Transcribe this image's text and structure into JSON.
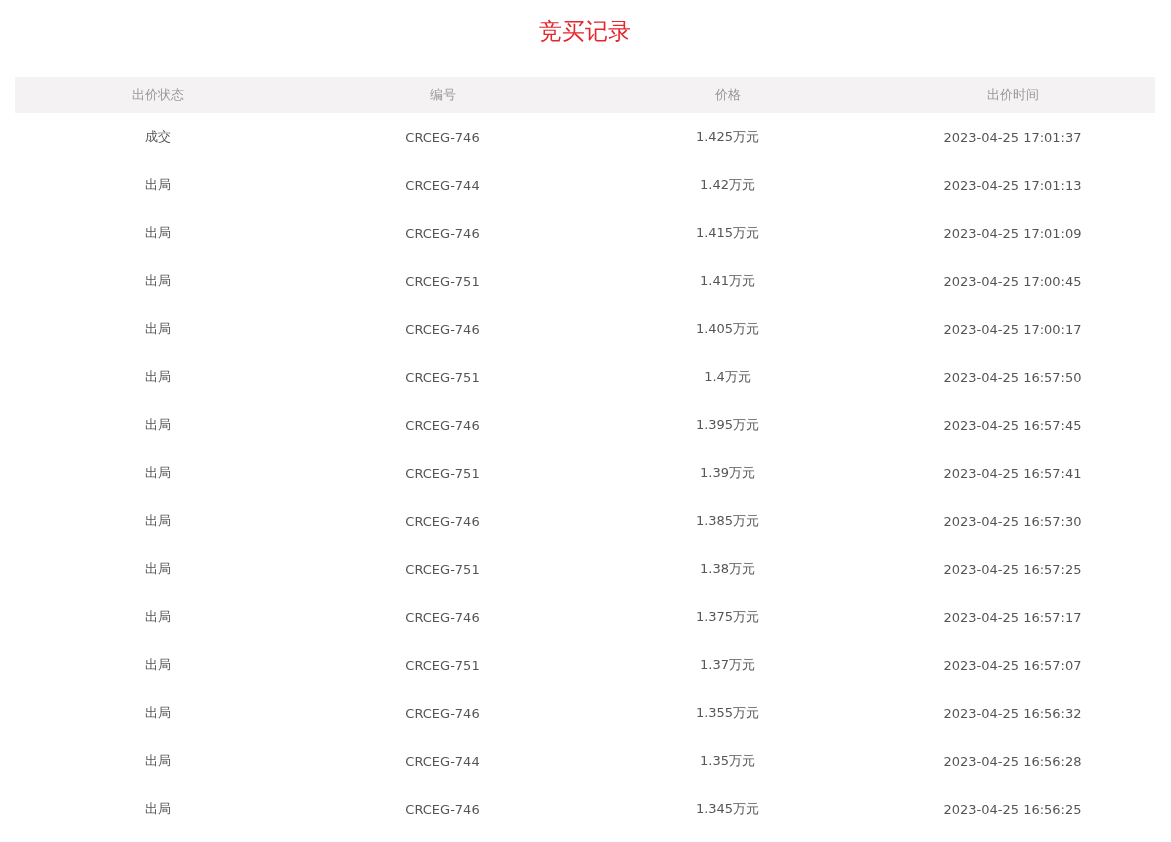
{
  "title": "竞买记录",
  "table": {
    "columns": [
      "出价状态",
      "编号",
      "价格",
      "出价时间"
    ],
    "rows": [
      [
        "成交",
        "CRCEG-746",
        "1.425万元",
        "2023-04-25 17:01:37"
      ],
      [
        "出局",
        "CRCEG-744",
        "1.42万元",
        "2023-04-25 17:01:13"
      ],
      [
        "出局",
        "CRCEG-746",
        "1.415万元",
        "2023-04-25 17:01:09"
      ],
      [
        "出局",
        "CRCEG-751",
        "1.41万元",
        "2023-04-25 17:00:45"
      ],
      [
        "出局",
        "CRCEG-746",
        "1.405万元",
        "2023-04-25 17:00:17"
      ],
      [
        "出局",
        "CRCEG-751",
        "1.4万元",
        "2023-04-25 16:57:50"
      ],
      [
        "出局",
        "CRCEG-746",
        "1.395万元",
        "2023-04-25 16:57:45"
      ],
      [
        "出局",
        "CRCEG-751",
        "1.39万元",
        "2023-04-25 16:57:41"
      ],
      [
        "出局",
        "CRCEG-746",
        "1.385万元",
        "2023-04-25 16:57:30"
      ],
      [
        "出局",
        "CRCEG-751",
        "1.38万元",
        "2023-04-25 16:57:25"
      ],
      [
        "出局",
        "CRCEG-746",
        "1.375万元",
        "2023-04-25 16:57:17"
      ],
      [
        "出局",
        "CRCEG-751",
        "1.37万元",
        "2023-04-25 16:57:07"
      ],
      [
        "出局",
        "CRCEG-746",
        "1.355万元",
        "2023-04-25 16:56:32"
      ],
      [
        "出局",
        "CRCEG-744",
        "1.35万元",
        "2023-04-25 16:56:28"
      ],
      [
        "出局",
        "CRCEG-746",
        "1.345万元",
        "2023-04-25 16:56:25"
      ]
    ]
  }
}
